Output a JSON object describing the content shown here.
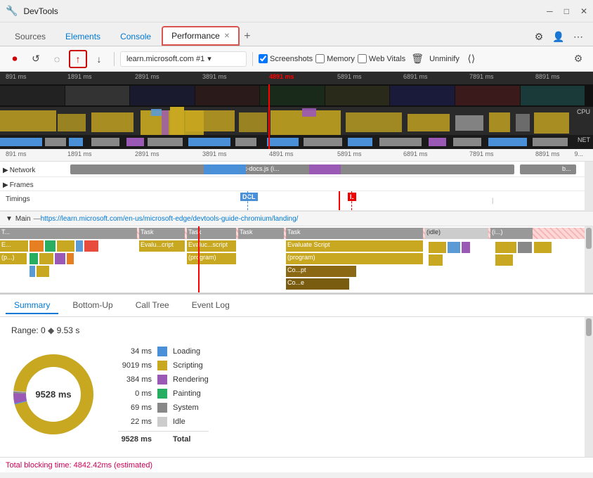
{
  "titleBar": {
    "icon": "🔧",
    "title": "DevTools",
    "controls": [
      "minimize",
      "maximize",
      "close"
    ]
  },
  "tabs": [
    {
      "id": "sources",
      "label": "Sources",
      "active": false
    },
    {
      "id": "elements",
      "label": "Elements",
      "active": false
    },
    {
      "id": "console",
      "label": "Console",
      "active": false
    },
    {
      "id": "performance",
      "label": "Performance",
      "active": true,
      "hasClose": true
    }
  ],
  "toolbar": {
    "url": "learn.microsoft.com #1",
    "screenshots_label": "Screenshots",
    "memory_label": "Memory",
    "webvitals_label": "Web Vitals",
    "unminify_label": "Unminify"
  },
  "timeline": {
    "ticks": [
      "891 ms",
      "1891 ms",
      "2891 ms",
      "3891 ms",
      "4891 ms",
      "5891 ms",
      "6891 ms",
      "7891 ms",
      "8891 ms"
    ],
    "ticks2": [
      "891 ms",
      "1891 ms",
      "2891 ms",
      "3891 ms",
      "4891 ms",
      "5891 ms",
      "6891 ms",
      "7891 ms",
      "8891 ms",
      "9..."
    ],
    "cpu_label": "CPU",
    "net_label": "NET",
    "network_row_label": "Network",
    "network_file": "0a85bf.index-docs.js (i...",
    "frames_label": "Frames",
    "timings_label": "Timings",
    "dcl_label": "DCL",
    "l_label": "L",
    "main_label": "Main",
    "main_url": "https://learn.microsoft.com/en-us/microsoft-edge/devtools-guide-chromium/landing/",
    "task_labels": [
      "T...",
      "Task",
      "Task",
      "Task",
      "Task"
    ],
    "idle_label": "(idle)",
    "evaluate_label": "Evaluate Script",
    "program_label": "(program)",
    "compile_label": "Co...pt",
    "compile2_label": "Co...e"
  },
  "bottomPanel": {
    "tabs": [
      "Summary",
      "Bottom-Up",
      "Call Tree",
      "Event Log"
    ],
    "activeTab": "Summary",
    "range": "Range: 0",
    "range_diamond": "◆",
    "range_value": "9.53 s",
    "donut_center_label": "9528 ms",
    "legend": [
      {
        "ms": "34 ms",
        "color": "#4a90d9",
        "label": "Loading"
      },
      {
        "ms": "9019 ms",
        "color": "#c8a820",
        "label": "Scripting"
      },
      {
        "ms": "384 ms",
        "color": "#9b59b6",
        "label": "Rendering"
      },
      {
        "ms": "0 ms",
        "color": "#27ae60",
        "label": "Painting"
      },
      {
        "ms": "69 ms",
        "color": "#888888",
        "label": "System"
      },
      {
        "ms": "22 ms",
        "color": "#cccccc",
        "label": "Idle"
      }
    ],
    "total_ms": "9528 ms",
    "total_label": "Total"
  },
  "statusBar": {
    "text": "Total blocking time: 4842.42ms (estimated)"
  }
}
